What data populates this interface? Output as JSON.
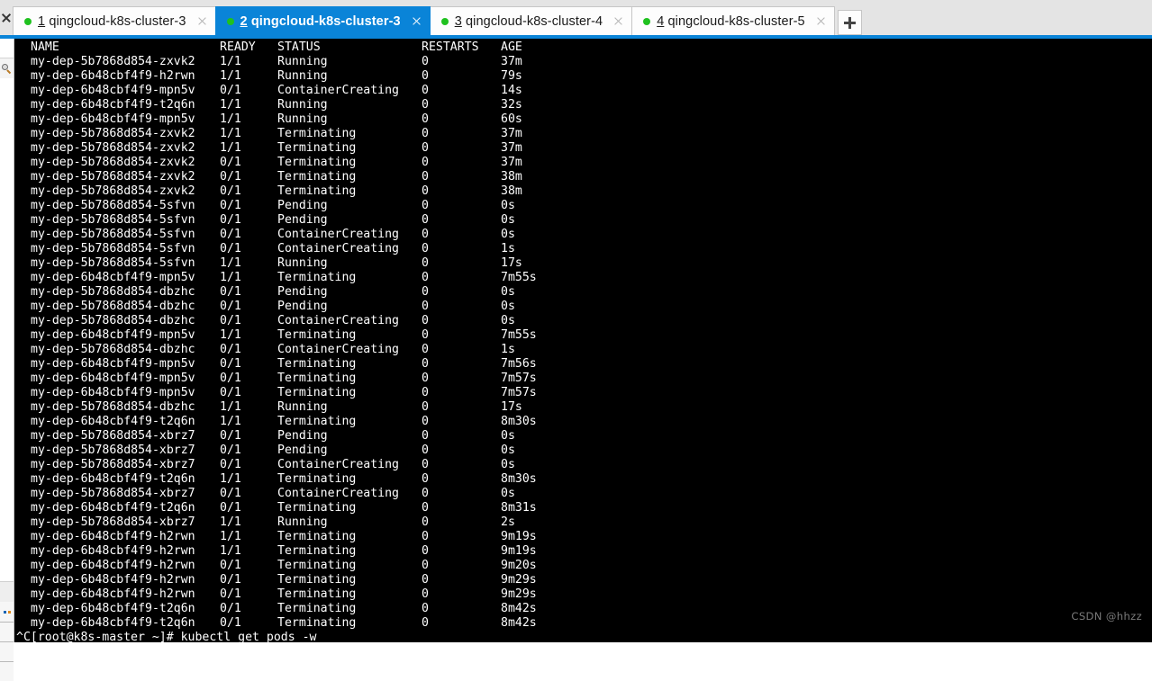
{
  "window": {
    "accent_color": "#0a84d8",
    "terminal_bg": "#000000",
    "terminal_fg": "#ffffff",
    "close_gutter_icon": "close-icon"
  },
  "tabs": {
    "items": [
      {
        "index": "1",
        "title": "qingcloud-k8s-cluster-3",
        "active": false,
        "status_dot": "green",
        "close_icon": "close-icon"
      },
      {
        "index": "2",
        "title": "qingcloud-k8s-cluster-3",
        "active": true,
        "status_dot": "green",
        "close_icon": "close-icon"
      },
      {
        "index": "3",
        "title": "qingcloud-k8s-cluster-4",
        "active": false,
        "status_dot": "green",
        "close_icon": "close-icon"
      },
      {
        "index": "4",
        "title": "qingcloud-k8s-cluster-5",
        "active": false,
        "status_dot": "green",
        "close_icon": "close-icon"
      }
    ],
    "new_tab_icon": "plus-icon",
    "new_tab_label": "+"
  },
  "sidebar": {
    "search_icon": "magnifier-icon",
    "dots_icon": "color-dots-icon"
  },
  "terminal": {
    "headers": {
      "name": "NAME",
      "ready": "READY",
      "status": "STATUS",
      "restarts": "RESTARTS",
      "age": "AGE"
    },
    "rows": [
      {
        "name": "my-dep-5b7868d854-zxvk2",
        "ready": "1/1",
        "status": "Running",
        "restarts": "0",
        "age": "37m"
      },
      {
        "name": "my-dep-6b48cbf4f9-h2rwn",
        "ready": "1/1",
        "status": "Running",
        "restarts": "0",
        "age": "79s"
      },
      {
        "name": "my-dep-6b48cbf4f9-mpn5v",
        "ready": "0/1",
        "status": "ContainerCreating",
        "restarts": "0",
        "age": "14s"
      },
      {
        "name": "my-dep-6b48cbf4f9-t2q6n",
        "ready": "1/1",
        "status": "Running",
        "restarts": "0",
        "age": "32s"
      },
      {
        "name": "my-dep-6b48cbf4f9-mpn5v",
        "ready": "1/1",
        "status": "Running",
        "restarts": "0",
        "age": "60s"
      },
      {
        "name": "my-dep-5b7868d854-zxvk2",
        "ready": "1/1",
        "status": "Terminating",
        "restarts": "0",
        "age": "37m"
      },
      {
        "name": "my-dep-5b7868d854-zxvk2",
        "ready": "1/1",
        "status": "Terminating",
        "restarts": "0",
        "age": "37m"
      },
      {
        "name": "my-dep-5b7868d854-zxvk2",
        "ready": "0/1",
        "status": "Terminating",
        "restarts": "0",
        "age": "37m"
      },
      {
        "name": "my-dep-5b7868d854-zxvk2",
        "ready": "0/1",
        "status": "Terminating",
        "restarts": "0",
        "age": "38m"
      },
      {
        "name": "my-dep-5b7868d854-zxvk2",
        "ready": "0/1",
        "status": "Terminating",
        "restarts": "0",
        "age": "38m"
      },
      {
        "name": "my-dep-5b7868d854-5sfvn",
        "ready": "0/1",
        "status": "Pending",
        "restarts": "0",
        "age": "0s"
      },
      {
        "name": "my-dep-5b7868d854-5sfvn",
        "ready": "0/1",
        "status": "Pending",
        "restarts": "0",
        "age": "0s"
      },
      {
        "name": "my-dep-5b7868d854-5sfvn",
        "ready": "0/1",
        "status": "ContainerCreating",
        "restarts": "0",
        "age": "0s"
      },
      {
        "name": "my-dep-5b7868d854-5sfvn",
        "ready": "0/1",
        "status": "ContainerCreating",
        "restarts": "0",
        "age": "1s"
      },
      {
        "name": "my-dep-5b7868d854-5sfvn",
        "ready": "1/1",
        "status": "Running",
        "restarts": "0",
        "age": "17s"
      },
      {
        "name": "my-dep-6b48cbf4f9-mpn5v",
        "ready": "1/1",
        "status": "Terminating",
        "restarts": "0",
        "age": "7m55s"
      },
      {
        "name": "my-dep-5b7868d854-dbzhc",
        "ready": "0/1",
        "status": "Pending",
        "restarts": "0",
        "age": "0s"
      },
      {
        "name": "my-dep-5b7868d854-dbzhc",
        "ready": "0/1",
        "status": "Pending",
        "restarts": "0",
        "age": "0s"
      },
      {
        "name": "my-dep-5b7868d854-dbzhc",
        "ready": "0/1",
        "status": "ContainerCreating",
        "restarts": "0",
        "age": "0s"
      },
      {
        "name": "my-dep-6b48cbf4f9-mpn5v",
        "ready": "1/1",
        "status": "Terminating",
        "restarts": "0",
        "age": "7m55s"
      },
      {
        "name": "my-dep-5b7868d854-dbzhc",
        "ready": "0/1",
        "status": "ContainerCreating",
        "restarts": "0",
        "age": "1s"
      },
      {
        "name": "my-dep-6b48cbf4f9-mpn5v",
        "ready": "0/1",
        "status": "Terminating",
        "restarts": "0",
        "age": "7m56s"
      },
      {
        "name": "my-dep-6b48cbf4f9-mpn5v",
        "ready": "0/1",
        "status": "Terminating",
        "restarts": "0",
        "age": "7m57s"
      },
      {
        "name": "my-dep-6b48cbf4f9-mpn5v",
        "ready": "0/1",
        "status": "Terminating",
        "restarts": "0",
        "age": "7m57s"
      },
      {
        "name": "my-dep-5b7868d854-dbzhc",
        "ready": "1/1",
        "status": "Running",
        "restarts": "0",
        "age": "17s"
      },
      {
        "name": "my-dep-6b48cbf4f9-t2q6n",
        "ready": "1/1",
        "status": "Terminating",
        "restarts": "0",
        "age": "8m30s"
      },
      {
        "name": "my-dep-5b7868d854-xbrz7",
        "ready": "0/1",
        "status": "Pending",
        "restarts": "0",
        "age": "0s"
      },
      {
        "name": "my-dep-5b7868d854-xbrz7",
        "ready": "0/1",
        "status": "Pending",
        "restarts": "0",
        "age": "0s"
      },
      {
        "name": "my-dep-5b7868d854-xbrz7",
        "ready": "0/1",
        "status": "ContainerCreating",
        "restarts": "0",
        "age": "0s"
      },
      {
        "name": "my-dep-6b48cbf4f9-t2q6n",
        "ready": "1/1",
        "status": "Terminating",
        "restarts": "0",
        "age": "8m30s"
      },
      {
        "name": "my-dep-5b7868d854-xbrz7",
        "ready": "0/1",
        "status": "ContainerCreating",
        "restarts": "0",
        "age": "0s"
      },
      {
        "name": "my-dep-6b48cbf4f9-t2q6n",
        "ready": "0/1",
        "status": "Terminating",
        "restarts": "0",
        "age": "8m31s"
      },
      {
        "name": "my-dep-5b7868d854-xbrz7",
        "ready": "1/1",
        "status": "Running",
        "restarts": "0",
        "age": "2s"
      },
      {
        "name": "my-dep-6b48cbf4f9-h2rwn",
        "ready": "1/1",
        "status": "Terminating",
        "restarts": "0",
        "age": "9m19s"
      },
      {
        "name": "my-dep-6b48cbf4f9-h2rwn",
        "ready": "1/1",
        "status": "Terminating",
        "restarts": "0",
        "age": "9m19s"
      },
      {
        "name": "my-dep-6b48cbf4f9-h2rwn",
        "ready": "0/1",
        "status": "Terminating",
        "restarts": "0",
        "age": "9m20s"
      },
      {
        "name": "my-dep-6b48cbf4f9-h2rwn",
        "ready": "0/1",
        "status": "Terminating",
        "restarts": "0",
        "age": "9m29s"
      },
      {
        "name": "my-dep-6b48cbf4f9-h2rwn",
        "ready": "0/1",
        "status": "Terminating",
        "restarts": "0",
        "age": "9m29s"
      },
      {
        "name": "my-dep-6b48cbf4f9-t2q6n",
        "ready": "0/1",
        "status": "Terminating",
        "restarts": "0",
        "age": "8m42s"
      },
      {
        "name": "my-dep-6b48cbf4f9-t2q6n",
        "ready": "0/1",
        "status": "Terminating",
        "restarts": "0",
        "age": "8m42s"
      }
    ],
    "prompt_line": "^C[root@k8s-master ~]# kubectl get pods -w"
  },
  "watermark": "CSDN @hhzz"
}
